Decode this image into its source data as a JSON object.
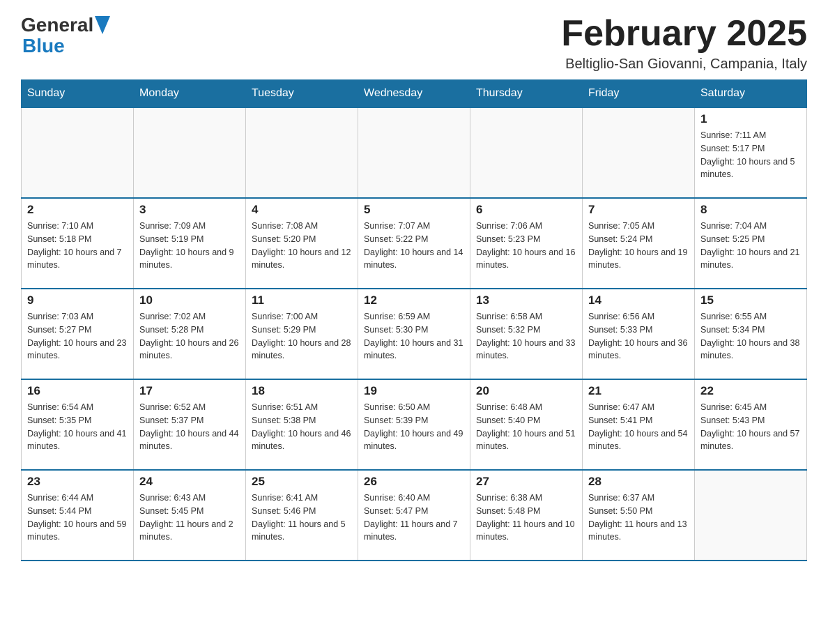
{
  "header": {
    "logo_text_general": "General",
    "logo_text_blue": "Blue",
    "month_title": "February 2025",
    "location": "Beltiglio-San Giovanni, Campania, Italy"
  },
  "days_of_week": [
    "Sunday",
    "Monday",
    "Tuesday",
    "Wednesday",
    "Thursday",
    "Friday",
    "Saturday"
  ],
  "weeks": [
    [
      {
        "day": "",
        "info": ""
      },
      {
        "day": "",
        "info": ""
      },
      {
        "day": "",
        "info": ""
      },
      {
        "day": "",
        "info": ""
      },
      {
        "day": "",
        "info": ""
      },
      {
        "day": "",
        "info": ""
      },
      {
        "day": "1",
        "info": "Sunrise: 7:11 AM\nSunset: 5:17 PM\nDaylight: 10 hours and 5 minutes."
      }
    ],
    [
      {
        "day": "2",
        "info": "Sunrise: 7:10 AM\nSunset: 5:18 PM\nDaylight: 10 hours and 7 minutes."
      },
      {
        "day": "3",
        "info": "Sunrise: 7:09 AM\nSunset: 5:19 PM\nDaylight: 10 hours and 9 minutes."
      },
      {
        "day": "4",
        "info": "Sunrise: 7:08 AM\nSunset: 5:20 PM\nDaylight: 10 hours and 12 minutes."
      },
      {
        "day": "5",
        "info": "Sunrise: 7:07 AM\nSunset: 5:22 PM\nDaylight: 10 hours and 14 minutes."
      },
      {
        "day": "6",
        "info": "Sunrise: 7:06 AM\nSunset: 5:23 PM\nDaylight: 10 hours and 16 minutes."
      },
      {
        "day": "7",
        "info": "Sunrise: 7:05 AM\nSunset: 5:24 PM\nDaylight: 10 hours and 19 minutes."
      },
      {
        "day": "8",
        "info": "Sunrise: 7:04 AM\nSunset: 5:25 PM\nDaylight: 10 hours and 21 minutes."
      }
    ],
    [
      {
        "day": "9",
        "info": "Sunrise: 7:03 AM\nSunset: 5:27 PM\nDaylight: 10 hours and 23 minutes."
      },
      {
        "day": "10",
        "info": "Sunrise: 7:02 AM\nSunset: 5:28 PM\nDaylight: 10 hours and 26 minutes."
      },
      {
        "day": "11",
        "info": "Sunrise: 7:00 AM\nSunset: 5:29 PM\nDaylight: 10 hours and 28 minutes."
      },
      {
        "day": "12",
        "info": "Sunrise: 6:59 AM\nSunset: 5:30 PM\nDaylight: 10 hours and 31 minutes."
      },
      {
        "day": "13",
        "info": "Sunrise: 6:58 AM\nSunset: 5:32 PM\nDaylight: 10 hours and 33 minutes."
      },
      {
        "day": "14",
        "info": "Sunrise: 6:56 AM\nSunset: 5:33 PM\nDaylight: 10 hours and 36 minutes."
      },
      {
        "day": "15",
        "info": "Sunrise: 6:55 AM\nSunset: 5:34 PM\nDaylight: 10 hours and 38 minutes."
      }
    ],
    [
      {
        "day": "16",
        "info": "Sunrise: 6:54 AM\nSunset: 5:35 PM\nDaylight: 10 hours and 41 minutes."
      },
      {
        "day": "17",
        "info": "Sunrise: 6:52 AM\nSunset: 5:37 PM\nDaylight: 10 hours and 44 minutes."
      },
      {
        "day": "18",
        "info": "Sunrise: 6:51 AM\nSunset: 5:38 PM\nDaylight: 10 hours and 46 minutes."
      },
      {
        "day": "19",
        "info": "Sunrise: 6:50 AM\nSunset: 5:39 PM\nDaylight: 10 hours and 49 minutes."
      },
      {
        "day": "20",
        "info": "Sunrise: 6:48 AM\nSunset: 5:40 PM\nDaylight: 10 hours and 51 minutes."
      },
      {
        "day": "21",
        "info": "Sunrise: 6:47 AM\nSunset: 5:41 PM\nDaylight: 10 hours and 54 minutes."
      },
      {
        "day": "22",
        "info": "Sunrise: 6:45 AM\nSunset: 5:43 PM\nDaylight: 10 hours and 57 minutes."
      }
    ],
    [
      {
        "day": "23",
        "info": "Sunrise: 6:44 AM\nSunset: 5:44 PM\nDaylight: 10 hours and 59 minutes."
      },
      {
        "day": "24",
        "info": "Sunrise: 6:43 AM\nSunset: 5:45 PM\nDaylight: 11 hours and 2 minutes."
      },
      {
        "day": "25",
        "info": "Sunrise: 6:41 AM\nSunset: 5:46 PM\nDaylight: 11 hours and 5 minutes."
      },
      {
        "day": "26",
        "info": "Sunrise: 6:40 AM\nSunset: 5:47 PM\nDaylight: 11 hours and 7 minutes."
      },
      {
        "day": "27",
        "info": "Sunrise: 6:38 AM\nSunset: 5:48 PM\nDaylight: 11 hours and 10 minutes."
      },
      {
        "day": "28",
        "info": "Sunrise: 6:37 AM\nSunset: 5:50 PM\nDaylight: 11 hours and 13 minutes."
      },
      {
        "day": "",
        "info": ""
      }
    ]
  ]
}
